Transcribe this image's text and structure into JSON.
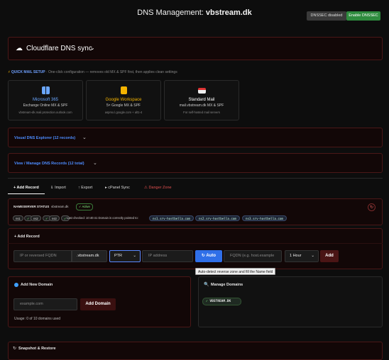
{
  "header": {
    "title_prefix": "DNS Management: ",
    "domain": "vbstream.dk",
    "dnssec_status": "DNSSEC disabled",
    "enable_label": "Enable DNSSEC"
  },
  "cloudflare": {
    "label": "Cloudflare DNS sync",
    "icon": "cloud-icon"
  },
  "quick_mail": {
    "label": "QUICK MAIL SETUP",
    "subtitle": "· One-click configuration — removes old MX & SPF first, then applies clean settings",
    "cards": [
      {
        "title": "Microsoft 365",
        "subtitle": "Exchange Online MX & SPF",
        "meta": "vbstream-dk.mail.protection.outlook.com",
        "icon": "windows-icon",
        "color": "#6aa6ff"
      },
      {
        "title": "Google Workspace",
        "subtitle": "5× Google MX & SPF",
        "meta": "aspmx.l.google.com + alt1-4",
        "icon": "google-icon",
        "color": "#f5b400"
      },
      {
        "title": "Standard Mail",
        "subtitle": "mail.vbstream.dk MX & SPF",
        "meta": "For self-hosted mail servers",
        "icon": "mail-icon",
        "color": "#ffffff"
      }
    ]
  },
  "explorer": {
    "label": "Visual DNS Explorer (12 records)"
  },
  "manage": {
    "label": "View / Manage DNS Records (12 total)"
  },
  "tabs": [
    {
      "label": "+ Add Record",
      "active": true
    },
    {
      "label": "⇓ Import"
    },
    {
      "label": "↑ Export"
    },
    {
      "label": "▸ cPanel Sync"
    },
    {
      "label": "⚠ Danger Zone",
      "danger": true
    }
  ],
  "nameserver": {
    "label": "NAMESERVER STATUS",
    "domain": "vbstream.dk",
    "active": "✓ Active",
    "chips": [
      "ns1",
      "✓",
      "ns2",
      "✓",
      "ns3",
      "✓"
    ],
    "checked": "Last checked: 10:40:41",
    "correct": "Domain is correctly pointed to:",
    "servers": [
      "ns1.srv-hostbella.com",
      "ns2.srv-hostbella.com",
      "ns3.srv-hostbella.com"
    ]
  },
  "add_record": {
    "title": "+ Add Record",
    "name_placeholder": "IP or reversed FQDN",
    "suffix": ".vbstream.dk",
    "type": "PTR",
    "ip_placeholder": "IP address",
    "auto_label": "↻ Auto",
    "fqdn_placeholder": "FQDN (e.g. host.example",
    "ttl": "1 Hour",
    "add_label": "Add",
    "tooltip": "Auto-detect reverse zone and fill the Name field"
  },
  "add_domain": {
    "title": "Add New Domain",
    "placeholder": "example.com",
    "button": "Add Domain",
    "usage": "Usage: 0 of 10 domains used"
  },
  "manage_domains": {
    "title": "Manage Domains",
    "domain": "VBSTREAM.DK"
  },
  "snapshot": {
    "label": "Snapshot & Restore"
  }
}
